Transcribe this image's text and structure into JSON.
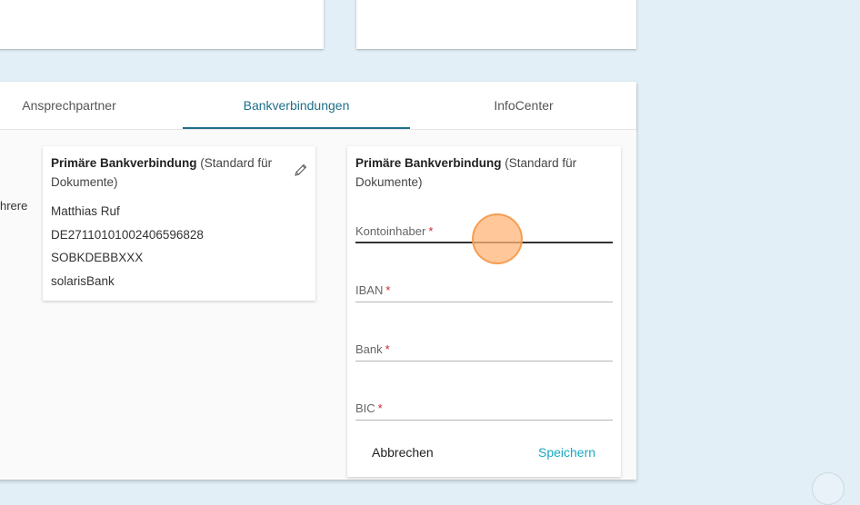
{
  "tabs": [
    {
      "label": "Ansprechpartner"
    },
    {
      "label": "Bankverbindungen"
    },
    {
      "label": "InfoCenter"
    }
  ],
  "left_truncated_text": "hrere",
  "bank_card": {
    "heading_bold": "Primäre Bankverbindung",
    "heading_rest": " (Standard für Dokumente)",
    "account_holder": "Matthias Ruf",
    "iban": "DE27110101002406596828",
    "bic": "SOBKDEBBXXX",
    "bank": "solarisBank"
  },
  "form_card": {
    "heading_bold": "Primäre Bankverbindung",
    "heading_rest": " (Standard für Dokumente)",
    "fields": [
      {
        "label": "Kontoinhaber",
        "required": "*"
      },
      {
        "label": "IBAN",
        "required": "*"
      },
      {
        "label": "Bank",
        "required": "*"
      },
      {
        "label": "BIC",
        "required": "*"
      }
    ],
    "cancel_label": "Abbrechen",
    "save_label": "Speichern"
  },
  "colors": {
    "page_background": "#e2eff7",
    "active_tab": "#1e6f8a",
    "save_button": "#19a8c2",
    "required_marker": "#c62828",
    "click_indicator": "#ffb478"
  },
  "icons": [
    "pencil-icon"
  ]
}
